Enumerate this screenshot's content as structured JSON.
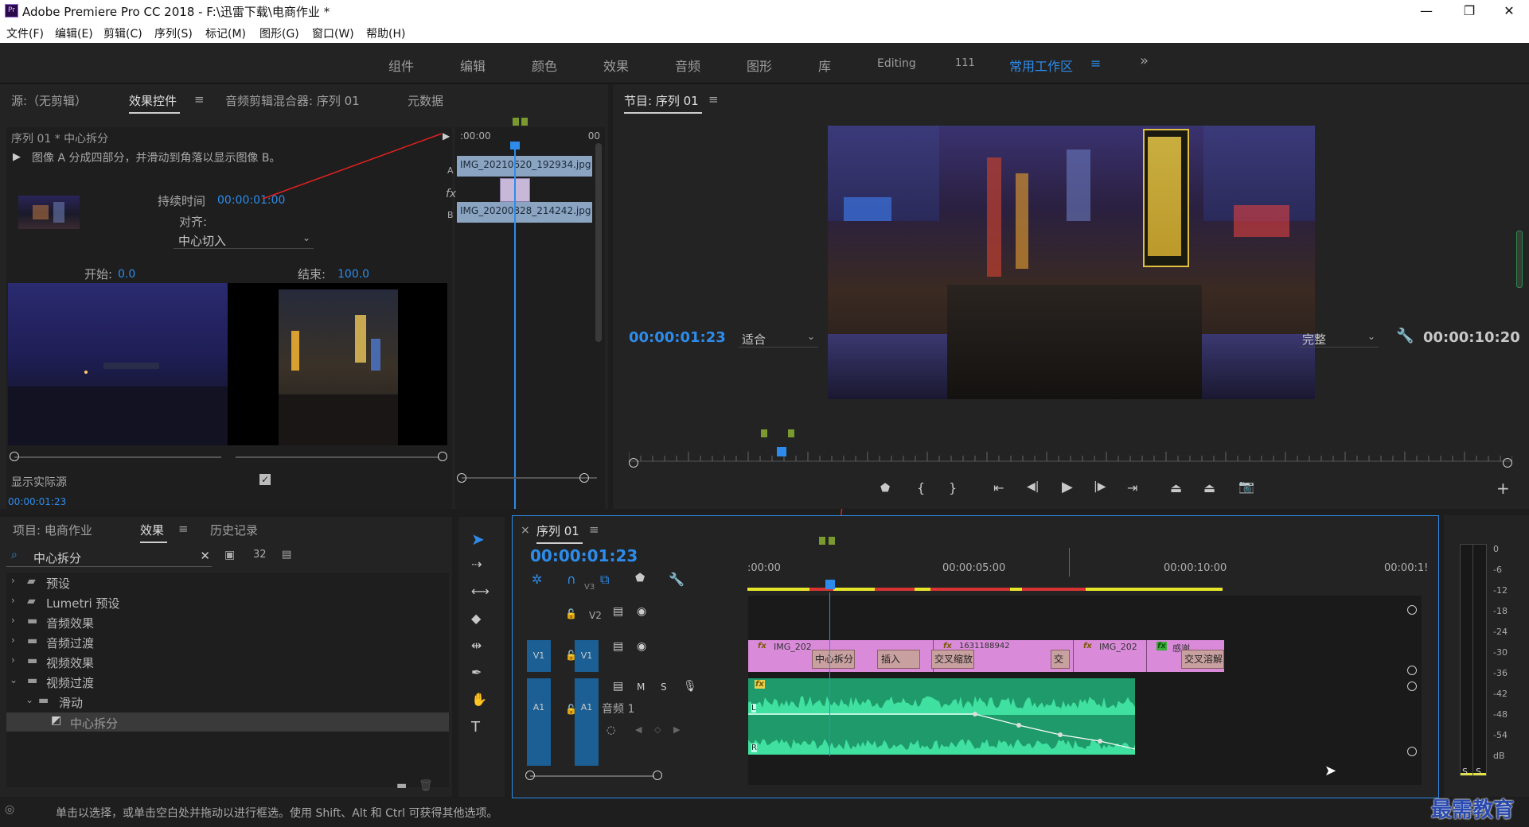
{
  "window": {
    "title": "Adobe Premiere Pro CC 2018 - F:\\迅雷下载\\电商作业 *",
    "logo_text": "Pr",
    "controls": {
      "minimize": "—",
      "restore": "❐",
      "close": "✕"
    }
  },
  "menu": [
    "文件(F)",
    "编辑(E)",
    "剪辑(C)",
    "序列(S)",
    "标记(M)",
    "图形(G)",
    "窗口(W)",
    "帮助(H)"
  ],
  "workspaces": [
    "组件",
    "编辑",
    "颜色",
    "效果",
    "音频",
    "图形",
    "库",
    "Editing",
    "111",
    "常用工作区"
  ],
  "workspace_active": "常用工作区",
  "workspace_more": "»",
  "source_panel": {
    "tabs": [
      "源:（无剪辑）",
      "效果控件",
      "音频剪辑混合器: 序列 01",
      "元数据"
    ],
    "active_tab": "效果控件",
    "clip_header": "序列 01 * 中心拆分",
    "description": "图像 A 分成四部分，并滑动到角落以显示图像 B。",
    "duration_label": "持续时间",
    "duration_value": "00:00:01:00",
    "align_label": "对齐:",
    "align_value": "中心切入",
    "start_label": "开始:",
    "start_value": "0.0",
    "end_label": "结束:",
    "end_value": "100.0",
    "show_actual_label": "显示实际源",
    "current_time": "00:00:01:23",
    "mini_timeline": {
      "time_start": ":00:00",
      "time_end": "00",
      "track_a_label": "A",
      "track_b_label": "B",
      "clip_a": "IMG_20210620_192934.jpg",
      "clip_b": "IMG_20200828_214242.jpg"
    }
  },
  "program_panel": {
    "title": "节目: 序列 01",
    "timecode": "00:00:01:23",
    "zoom_value": "适合",
    "quality_value": "完整",
    "duration": "00:00:10:20"
  },
  "project_panel": {
    "tabs": [
      "项目: 电商作业",
      "效果",
      "历史记录"
    ],
    "active_tab": "效果",
    "search_value": "中心拆分",
    "tree": [
      {
        "label": "预设",
        "indent": 0,
        "expanded": false
      },
      {
        "label": "Lumetri 预设",
        "indent": 0,
        "expanded": false
      },
      {
        "label": "音频效果",
        "indent": 0,
        "expanded": false
      },
      {
        "label": "音频过渡",
        "indent": 0,
        "expanded": false
      },
      {
        "label": "视频效果",
        "indent": 0,
        "expanded": false
      },
      {
        "label": "视频过渡",
        "indent": 0,
        "expanded": true
      },
      {
        "label": "滑动",
        "indent": 1,
        "expanded": true
      },
      {
        "label": "中心拆分",
        "indent": 2,
        "expanded": false
      }
    ]
  },
  "timeline": {
    "tab_label": "序列 01",
    "close_label": "×",
    "timecode": "00:00:01:23",
    "ruler": [
      ":00:00",
      "00:00:05:00",
      "00:00:10:00",
      "00:00:1!"
    ],
    "tracks": {
      "v3_label": "V3",
      "v2_label": "V2",
      "v1_label": "V1",
      "a1_label": "A1",
      "audio_name": "音频 1",
      "m_label": "M",
      "s_label": "S",
      "l_label": "L",
      "r_label": "R"
    },
    "video_clips": [
      {
        "label": "IMG_202",
        "fx": "fx"
      },
      {
        "label": "1631188942",
        "fx": "fx"
      },
      {
        "label": "IMG_202",
        "fx": "fx"
      },
      {
        "label": "感谢",
        "fx": "fx"
      }
    ],
    "transitions": [
      "中心拆分",
      "插入",
      "交叉缩放",
      "交",
      "交叉溶解"
    ],
    "audio_fx": "fx"
  },
  "meter": {
    "ticks": [
      "0",
      "-6",
      "-12",
      "-18",
      "-24",
      "-30",
      "-36",
      "-42",
      "-48",
      "-54",
      "dB"
    ],
    "solo_labels": [
      "S",
      "S"
    ]
  },
  "status_bar": {
    "text": "单击以选择，或单击空白处并拖动以进行框选。使用 Shift、Alt 和 Ctrl 可获得其他选项。"
  },
  "watermark": "最需教育",
  "colors": {
    "accent_blue": "#2d8ceb",
    "video_clip": "#d98ad9",
    "audio_clip": "#1f9a6a",
    "track_header_blue": "#1b5f94",
    "render_bar_yellow": "#e5e52a",
    "render_bar_red": "#d83333"
  }
}
